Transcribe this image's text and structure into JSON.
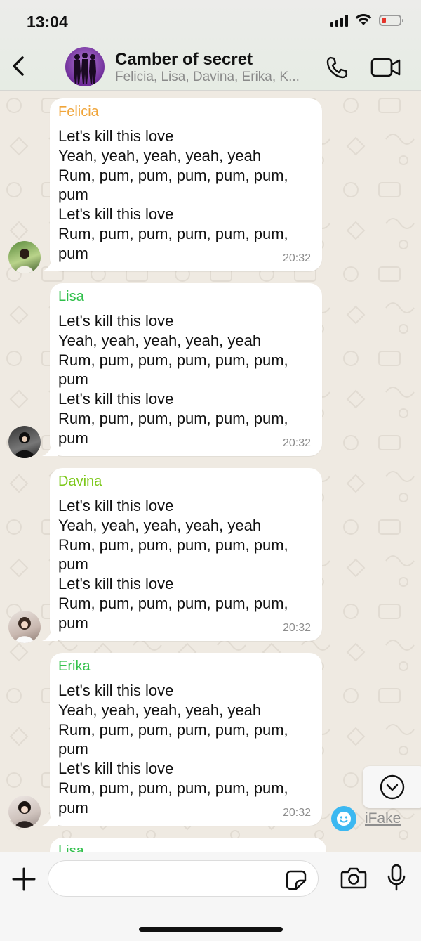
{
  "status_bar": {
    "time": "13:04"
  },
  "header": {
    "title": "Camber of secret",
    "subtitle": "Felicia, Lisa, Davina, Erika, K..."
  },
  "messages": [
    {
      "sender": "Felicia",
      "sender_color": "#f0a53a",
      "text": "Let's kill this love\nYeah, yeah, yeah, yeah, yeah\nRum, pum, pum, pum, pum, pum,\npum\nLet's kill this love\nRum, pum, pum, pum, pum, pum,\npum",
      "time": "20:32"
    },
    {
      "sender": "Lisa",
      "sender_color": "#2fbf4a",
      "text": "Let's kill this love\nYeah, yeah, yeah, yeah, yeah\nRum, pum, pum, pum, pum, pum,\npum\nLet's kill this love\nRum, pum, pum, pum, pum, pum,\npum",
      "time": "20:32"
    },
    {
      "sender": "Davina",
      "sender_color": "#7cc81a",
      "text": "Let's kill this love\nYeah, yeah, yeah, yeah, yeah\nRum, pum, pum, pum, pum, pum,\npum\nLet's kill this love\nRum, pum, pum, pum, pum, pum,\npum",
      "time": "20:32"
    },
    {
      "sender": "Erika",
      "sender_color": "#34c24c",
      "text": "Let's kill this love\nYeah, yeah, yeah, yeah, yeah\nRum, pum, pum, pum, pum, pum,\npum\nLet's kill this love\nRum, pum, pum, pum, pum, pum,\npum",
      "time": "20:32"
    },
    {
      "sender": "Lisa",
      "sender_color": "#2fbf4a",
      "text": "",
      "time": ""
    }
  ],
  "watermark": {
    "label": "iFake"
  },
  "composer": {
    "placeholder": ""
  },
  "icons": {
    "back": "chevron-left-icon",
    "call": "phone-icon",
    "video": "video-camera-icon",
    "scroll": "chevron-down-circle-icon",
    "plus": "plus-icon",
    "sticker": "sticker-icon",
    "camera": "camera-icon",
    "mic": "microphone-icon"
  },
  "colors": {
    "chat_background": "#efeae2",
    "bubble": "#ffffff",
    "battery_low": "#e5352b"
  }
}
